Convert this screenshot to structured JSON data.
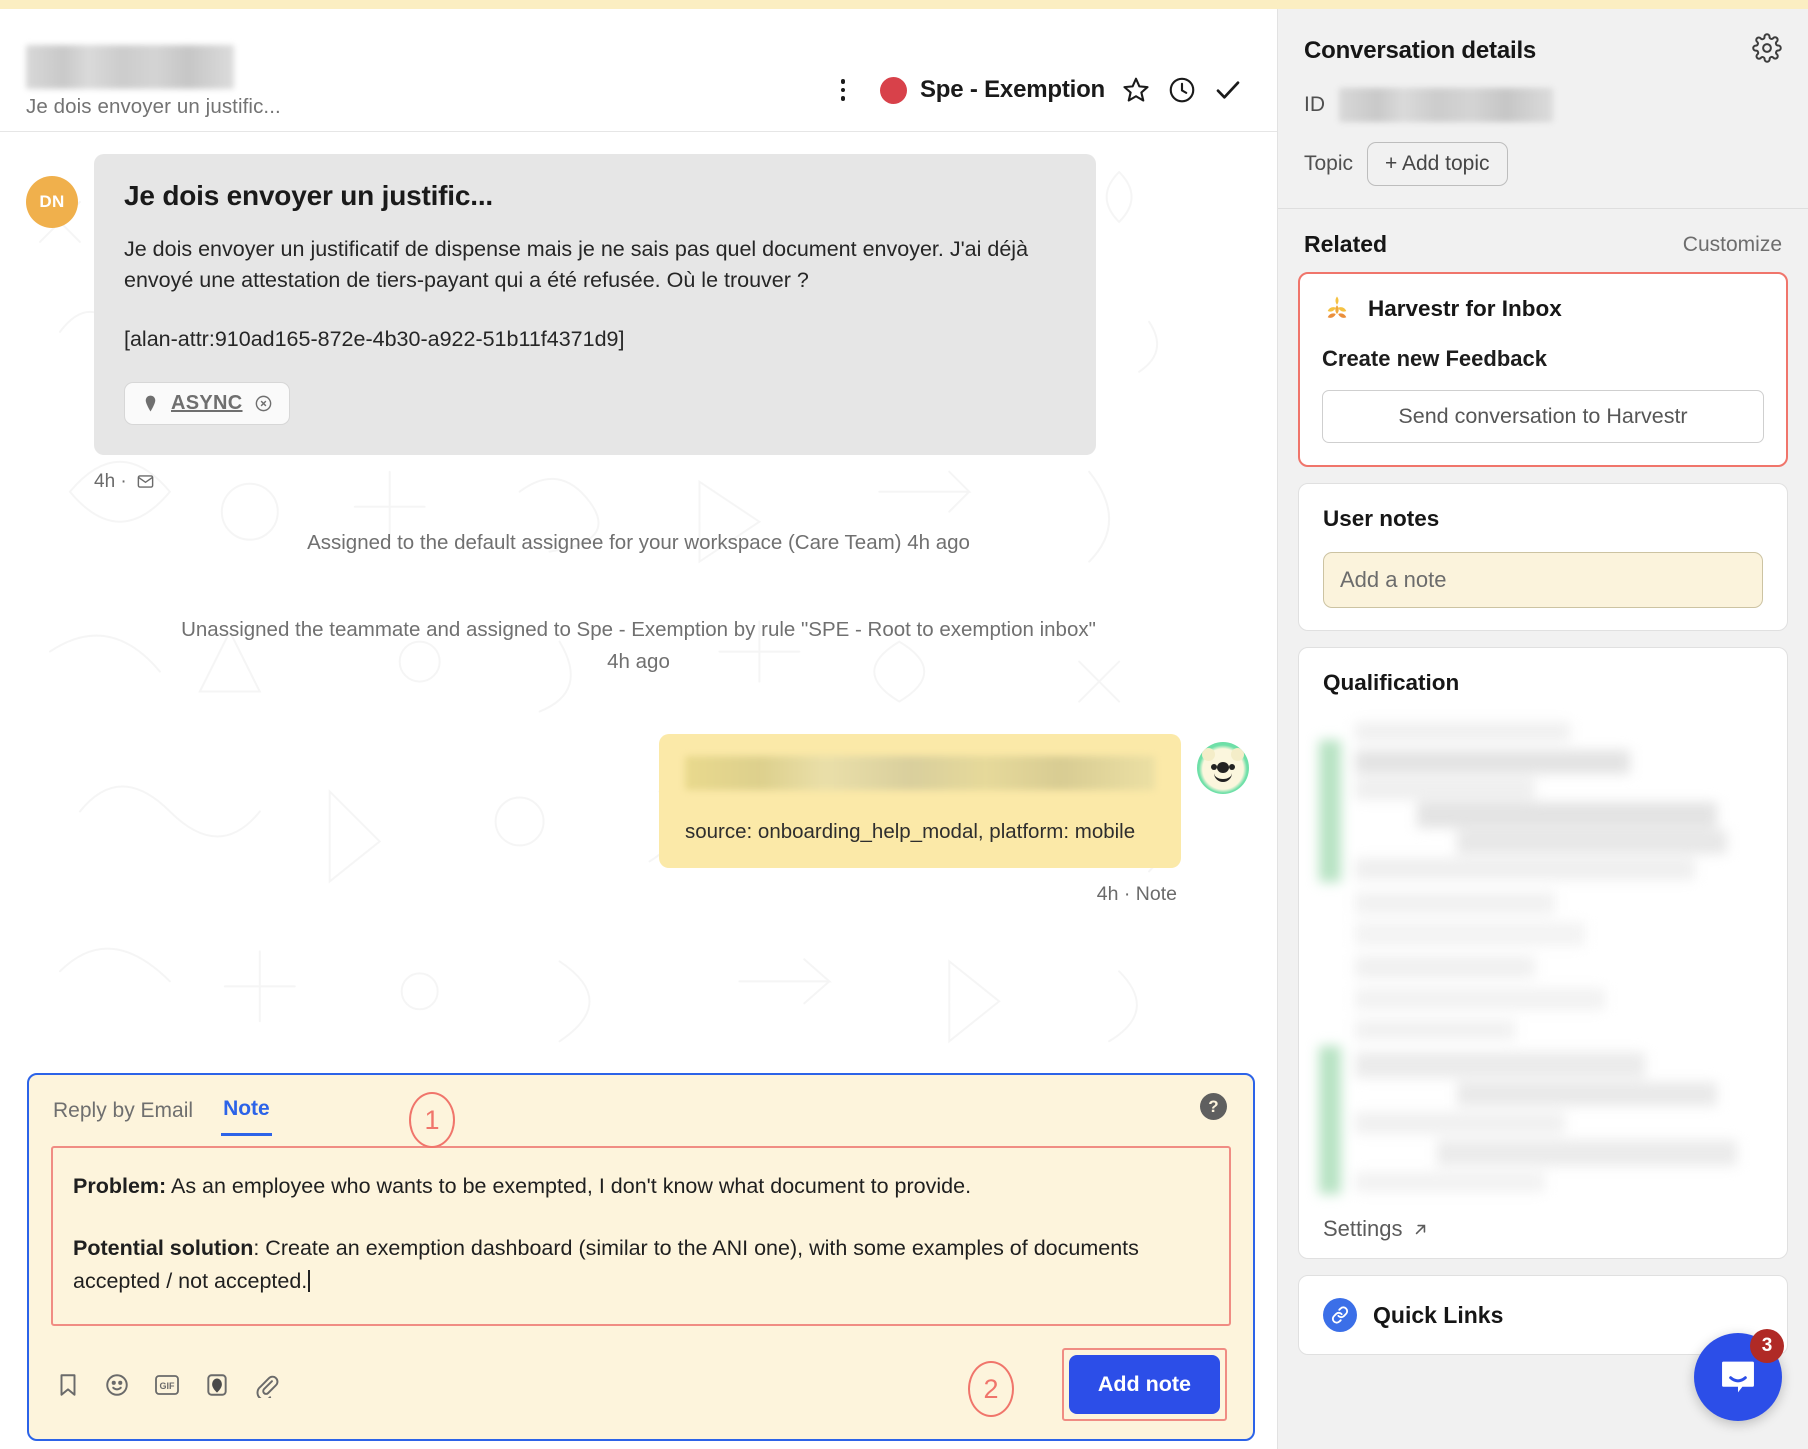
{
  "header": {
    "subject_preview": "Je dois envoyer un justific...",
    "assignee_label": "Spe - Exemption",
    "assignee_color": "#d8414a",
    "icons": {
      "kebab": "more-options-icon",
      "star": "star-icon",
      "snooze": "clock-snooze-icon",
      "close": "check-close-icon"
    }
  },
  "thread": {
    "author_initials": "DN",
    "message": {
      "title": "Je dois envoyer un justific...",
      "paragraph1": "Je dois envoyer un justificatif de dispense mais je ne sais pas quel document envoyer. J'ai déjà envoyé une attestation de tiers-payant qui a été refusée. Où le trouver ?",
      "paragraph2": "[alan-attr:910ad165-872e-4b30-a922-51b11f4371d9]",
      "tag_label": "ASYNC",
      "meta": "4h ·"
    },
    "system_events": [
      "Assigned to the default assignee for your workspace (Care Team) 4h ago",
      "Unassigned the teammate and assigned to Spe - Exemption by rule \"SPE - Root to exemption inbox\" 4h ago"
    ],
    "note_bubble": {
      "source_text": "source: onboarding_help_modal, platform: mobile",
      "meta": "4h · Note"
    }
  },
  "composer": {
    "tabs": [
      {
        "label": "Reply by Email",
        "active": false
      },
      {
        "label": "Note",
        "active": true
      }
    ],
    "help_glyph": "?",
    "note_line1_bold": "Problem:",
    "note_line1_rest": " As an employee who wants to be exempted, I don't know what document to provide.",
    "note_line2_bold": "Potential solution",
    "note_line2_rest": ": Create an exemption dashboard (similar to the ANI one), with some examples of documents accepted / not accepted.",
    "toolbar_icons": [
      "saved-replies-icon",
      "emoji-icon",
      "gif-icon",
      "image-icon",
      "attachment-icon"
    ],
    "submit_label": "Add note"
  },
  "annotations": {
    "step1": "1",
    "step2": "2",
    "step3": "3",
    "accent_color": "#f0756b"
  },
  "sidebar": {
    "details_title": "Conversation details",
    "gear_icon": "gear-icon",
    "id_label": "ID",
    "topic_label": "Topic",
    "add_topic_label": "+ Add topic",
    "related_title": "Related",
    "customize_label": "Customize",
    "harvestr": {
      "app_name": "Harvestr for Inbox",
      "section_label": "Create new Feedback",
      "send_button": "Send conversation to Harvestr",
      "icon": "harvestr-wheat-icon"
    },
    "user_notes": {
      "title": "User notes",
      "placeholder": "Add a note"
    },
    "qualification": {
      "title": "Qualification",
      "settings_label": "Settings"
    },
    "quick_links": {
      "title": "Quick Links",
      "icon": "link-icon"
    },
    "launcher": {
      "badge_count": "3",
      "icon": "messenger-icon"
    }
  }
}
